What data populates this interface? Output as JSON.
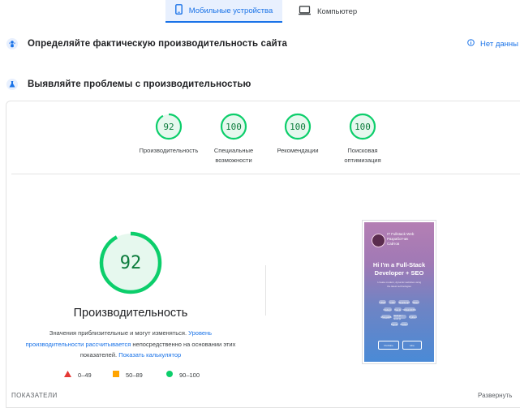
{
  "tabs": {
    "mobile": "Мобильные устройства",
    "desktop": "Компьютер"
  },
  "field_section": {
    "title": "Определяйте фактическую производительность сайта",
    "no_data": "Нет данны"
  },
  "lab_section": {
    "title": "Выявляйте проблемы с производительностью"
  },
  "scores": [
    {
      "value": "92",
      "label_1": "Производительность",
      "label_2": "",
      "fraction": 0.92
    },
    {
      "value": "100",
      "label_1": "Специальные",
      "label_2": "возможности",
      "fraction": 1.0
    },
    {
      "value": "100",
      "label_1": "Рекомендации",
      "label_2": "",
      "fraction": 1.0
    },
    {
      "value": "100",
      "label_1": "Поисковая",
      "label_2": "оптимизация",
      "fraction": 1.0
    }
  ],
  "performance": {
    "value": "92",
    "fraction": 0.92,
    "title": "Производительность",
    "desc_1": "Значения приблизительные и могут изменяться.",
    "desc_link_1": "Уровень производительности рассчитывается",
    "desc_2": "непосредственно на основании этих показателей.",
    "desc_link_2": "Показать калькулятор"
  },
  "legend": [
    {
      "range": "0–49",
      "color": "#e53935"
    },
    {
      "range": "50–89",
      "color": "#ffa400"
    },
    {
      "range": "90–100",
      "color": "#0cce6b"
    }
  ],
  "preview": {
    "name": "IT Fullstack Web",
    "role_1": "Разработчик",
    "role_2": "Сайтов",
    "headline_1": "Hi I'm a Full-Stack",
    "headline_2": "Developer + SEO",
    "sub_1": "I create modern, dynamic websites using",
    "sub_2": "the latest technologies",
    "tags": [
      "HTML",
      "CSS",
      "JavaScript",
      "React",
      "Node.js",
      "Vue.js",
      "TailwindCSS",
      "MongoDB",
      "Next.js / Nuxt.js",
      "Python",
      "Figma",
      "Docker"
    ],
    "btn_1": "Portfolio",
    "btn_2": "Hire"
  },
  "footer": {
    "metrics": "ПОКАЗАТЕЛИ",
    "expand": "Развернуть"
  },
  "colors": {
    "pass": "#0cce6b",
    "pass_text": "#0c7c3c",
    "pass_bg": "#e6f8ee",
    "accent": "#1a73e8"
  }
}
